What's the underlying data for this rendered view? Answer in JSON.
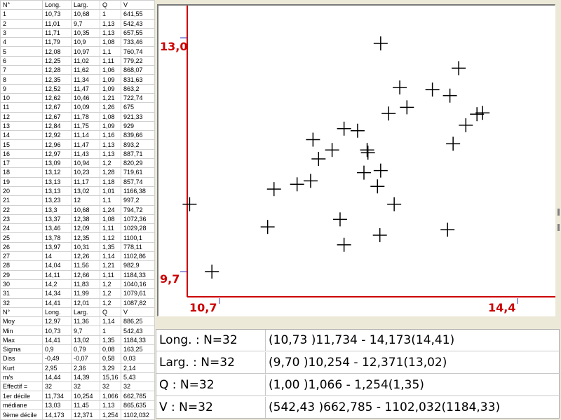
{
  "table": {
    "header": [
      "N°",
      "Long.",
      "Larg.",
      "Q",
      "V"
    ],
    "rows": [
      [
        "1",
        "10,73",
        "10,68",
        "1",
        "641,55"
      ],
      [
        "2",
        "11,01",
        "9,7",
        "1,13",
        "542,43"
      ],
      [
        "3",
        "11,71",
        "10,35",
        "1,13",
        "657,55"
      ],
      [
        "4",
        "11,79",
        "10,9",
        "1,08",
        "733,46"
      ],
      [
        "5",
        "12,08",
        "10,97",
        "1,1",
        "760,74"
      ],
      [
        "6",
        "12,25",
        "11,02",
        "1,11",
        "779,22"
      ],
      [
        "7",
        "12,28",
        "11,62",
        "1,06",
        "868,07"
      ],
      [
        "8",
        "12,35",
        "11,34",
        "1,09",
        "831,63"
      ],
      [
        "9",
        "12,52",
        "11,47",
        "1,09",
        "863,2"
      ],
      [
        "10",
        "12,62",
        "10,46",
        "1,21",
        "722,74"
      ],
      [
        "11",
        "12,67",
        "10,09",
        "1,26",
        "675"
      ],
      [
        "12",
        "12,67",
        "11,78",
        "1,08",
        "921,33"
      ],
      [
        "13",
        "12,84",
        "11,75",
        "1,09",
        "929"
      ],
      [
        "14",
        "12,92",
        "11,14",
        "1,16",
        "839,66"
      ],
      [
        "15",
        "12,96",
        "11,47",
        "1,13",
        "893,2"
      ],
      [
        "16",
        "12,97",
        "11,43",
        "1,13",
        "887,71"
      ],
      [
        "17",
        "13,09",
        "10,94",
        "1,2",
        "820,29"
      ],
      [
        "18",
        "13,12",
        "10,23",
        "1,28",
        "719,61"
      ],
      [
        "19",
        "13,13",
        "11,17",
        "1,18",
        "857,74"
      ],
      [
        "20",
        "13,13",
        "13,02",
        "1,01",
        "1166,38"
      ],
      [
        "21",
        "13,23",
        "12",
        "1,1",
        "997,2"
      ],
      [
        "22",
        "13,3",
        "10,68",
        "1,24",
        "794,72"
      ],
      [
        "23",
        "13,37",
        "12,38",
        "1,08",
        "1072,36"
      ],
      [
        "24",
        "13,46",
        "12,09",
        "1,11",
        "1029,28"
      ],
      [
        "25",
        "13,78",
        "12,35",
        "1,12",
        "1100,1"
      ],
      [
        "26",
        "13,97",
        "10,31",
        "1,35",
        "778,11"
      ],
      [
        "27",
        "14",
        "12,26",
        "1,14",
        "1102,86"
      ],
      [
        "28",
        "14,04",
        "11,56",
        "1,21",
        "982,9"
      ],
      [
        "29",
        "14,11",
        "12,66",
        "1,11",
        "1184,33"
      ],
      [
        "30",
        "14,2",
        "11,83",
        "1,2",
        "1040,16"
      ],
      [
        "31",
        "14,34",
        "11,99",
        "1,2",
        "1079,61"
      ],
      [
        "32",
        "14,41",
        "12,01",
        "1,2",
        "1087,82"
      ],
      [
        "N°",
        "Long.",
        "Larg.",
        "Q",
        "V"
      ],
      [
        "Moy",
        "12,97",
        "11,36",
        "1,14",
        "886,25"
      ],
      [
        "Min",
        "10,73",
        "9,7",
        "1",
        "542,43"
      ],
      [
        "Max",
        "14,41",
        "13,02",
        "1,35",
        "1184,33"
      ],
      [
        "Sigma",
        "0,9",
        "0,79",
        "0,08",
        "163,25"
      ],
      [
        "Diss",
        "-0,49",
        "-0,07",
        "0,58",
        "0,03"
      ],
      [
        "Kurt",
        "2,95",
        "2,36",
        "3,29",
        "2,14"
      ],
      [
        "m/s",
        "14,44",
        "14,39",
        "15,16",
        "5,43"
      ],
      [
        "Effectif =",
        "32",
        "32",
        "32",
        "32"
      ],
      [
        "1er décile",
        "11,734",
        "10,254",
        "1,066",
        "662,785"
      ],
      [
        "médiane",
        "13,03",
        "11,45",
        "1,13",
        "865,635"
      ],
      [
        "9ème décile",
        "14,173",
        "12,371",
        "1,254",
        "1102,032"
      ]
    ]
  },
  "chart_data": {
    "type": "scatter",
    "xlabel": "",
    "ylabel": "",
    "xlim": [
      10.7,
      14.4
    ],
    "ylim": [
      9.7,
      13.0
    ],
    "x_tick_labels": [
      "10,7",
      "14,4"
    ],
    "y_tick_labels": [
      "9,7",
      "13,0"
    ],
    "marker": "plus",
    "axis_color": "#cc0000",
    "points": [
      [
        10.73,
        10.68
      ],
      [
        11.01,
        9.7
      ],
      [
        11.71,
        10.35
      ],
      [
        11.79,
        10.9
      ],
      [
        12.08,
        10.97
      ],
      [
        12.25,
        11.02
      ],
      [
        12.28,
        11.62
      ],
      [
        12.35,
        11.34
      ],
      [
        12.52,
        11.47
      ],
      [
        12.62,
        10.46
      ],
      [
        12.67,
        10.09
      ],
      [
        12.67,
        11.78
      ],
      [
        12.84,
        11.75
      ],
      [
        12.92,
        11.14
      ],
      [
        12.96,
        11.47
      ],
      [
        12.97,
        11.43
      ],
      [
        13.09,
        10.94
      ],
      [
        13.12,
        10.23
      ],
      [
        13.13,
        11.17
      ],
      [
        13.13,
        13.02
      ],
      [
        13.23,
        12.0
      ],
      [
        13.3,
        10.68
      ],
      [
        13.37,
        12.38
      ],
      [
        13.46,
        12.09
      ],
      [
        13.78,
        12.35
      ],
      [
        13.97,
        10.31
      ],
      [
        14.0,
        12.26
      ],
      [
        14.04,
        11.56
      ],
      [
        14.11,
        12.66
      ],
      [
        14.2,
        11.83
      ],
      [
        14.34,
        11.99
      ],
      [
        14.41,
        12.01
      ]
    ]
  },
  "stats": [
    {
      "label": "Long. : N=32",
      "value": "(10,73 )11,734 - 14,173(14,41)"
    },
    {
      "label": "Larg. : N=32",
      "value": "(9,70 )10,254 - 12,371(13,02)"
    },
    {
      "label": "Q : N=32",
      "value": "(1,00 )1,066 - 1,254(1,35)"
    },
    {
      "label": "V : N=32",
      "value": "(542,43 )662,785 - 1102,032(1184,33)"
    }
  ]
}
